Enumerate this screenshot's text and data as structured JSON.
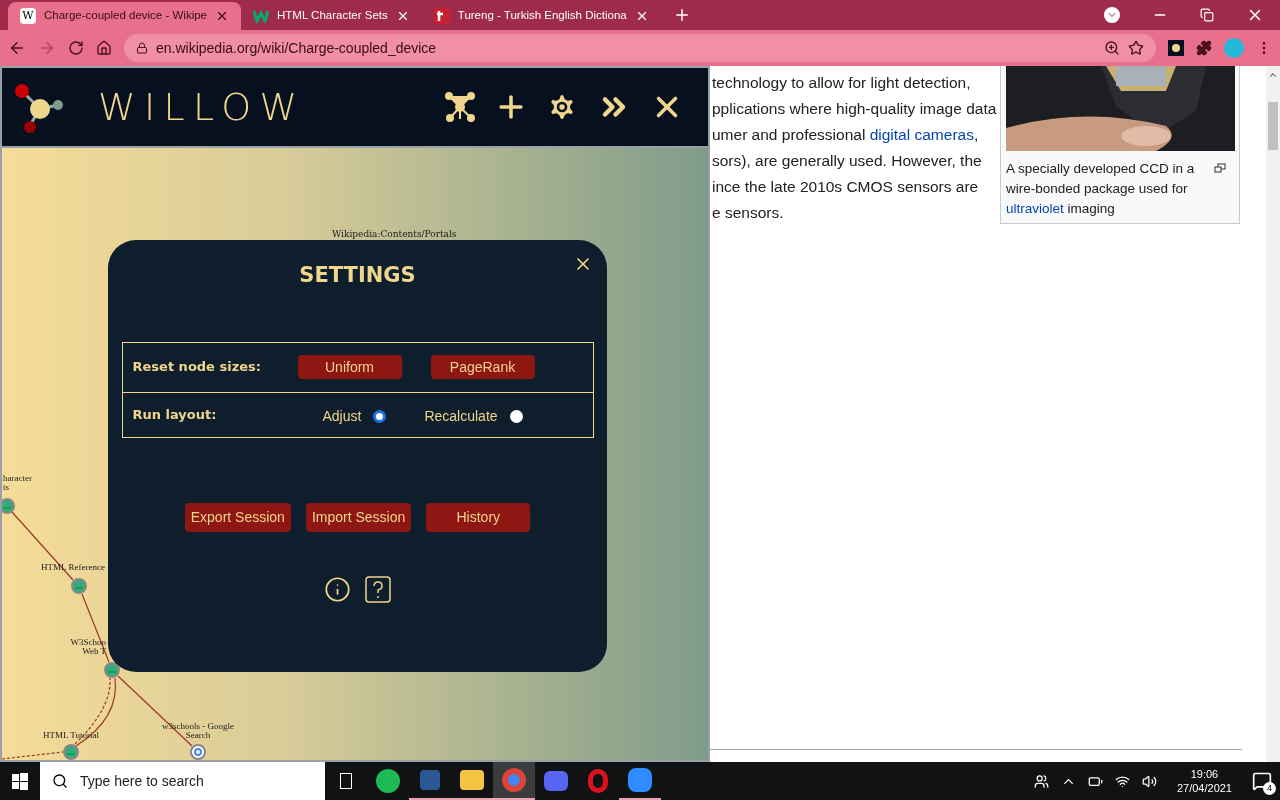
{
  "browser": {
    "tabs": [
      {
        "title": "Charge-coupled device - Wikipe",
        "selected": true,
        "kind": "wiki",
        "favicon": "W"
      },
      {
        "title": "HTML Character Sets",
        "selected": false,
        "kind": "w3"
      },
      {
        "title": "Tureng - Turkish English Dictiona",
        "selected": false,
        "kind": "tureng"
      }
    ],
    "url": "en.wikipedia.org/wiki/Charge-coupled_device"
  },
  "willow": {
    "title": "WILLOW",
    "graph": {
      "nodes": [
        {
          "lines": [
            "haracter",
            "ts"
          ],
          "kind": "w3"
        },
        {
          "lines": [
            "HTML Reference"
          ],
          "kind": "w3"
        },
        {
          "lines": [
            "W3Schoo",
            "Web T"
          ],
          "kind": "w3"
        },
        {
          "lines": [
            "HTML Tutorial"
          ],
          "kind": "w3"
        },
        {
          "lines": [
            "w3schools - Google",
            "Search"
          ],
          "kind": "google"
        }
      ],
      "labels": [
        "Wikipedia:Contents/Portals"
      ]
    },
    "settings": {
      "title": "SETTINGS",
      "reset_label": "Reset node sizes:",
      "reset_buttons": [
        "Uniform",
        "PageRank"
      ],
      "layout_label": "Run layout:",
      "layout_options": [
        {
          "label": "Adjust",
          "selected": true
        },
        {
          "label": "Recalculate",
          "selected": false
        }
      ],
      "session_buttons": [
        "Export Session",
        "Import Session",
        "History"
      ]
    }
  },
  "article": {
    "lines": [
      [
        {
          "text": "technology to allow for light detection,",
          "link": false
        }
      ],
      [
        {
          "text": "pplications where high-quality image data",
          "link": false
        }
      ],
      [
        {
          "text": "umer and professional ",
          "link": false
        },
        {
          "text": "digital cameras",
          "link": true
        },
        {
          "text": ",",
          "link": false
        }
      ],
      [
        {
          "text": "sors), are generally used. However, the",
          "link": false
        }
      ],
      [
        {
          "text": "ince the late 2010s CMOS sensors are",
          "link": false
        }
      ],
      [
        {
          "text": "e sensors.",
          "link": false
        }
      ]
    ],
    "caption": "A specially developed CCD in a wire-bonded package used for",
    "caption_link": "ultraviolet",
    "caption_end": " imaging"
  },
  "taskbar": {
    "search_placeholder": "Type here to search",
    "time": "19:06",
    "date": "27/04/2021",
    "notifications": "4"
  }
}
